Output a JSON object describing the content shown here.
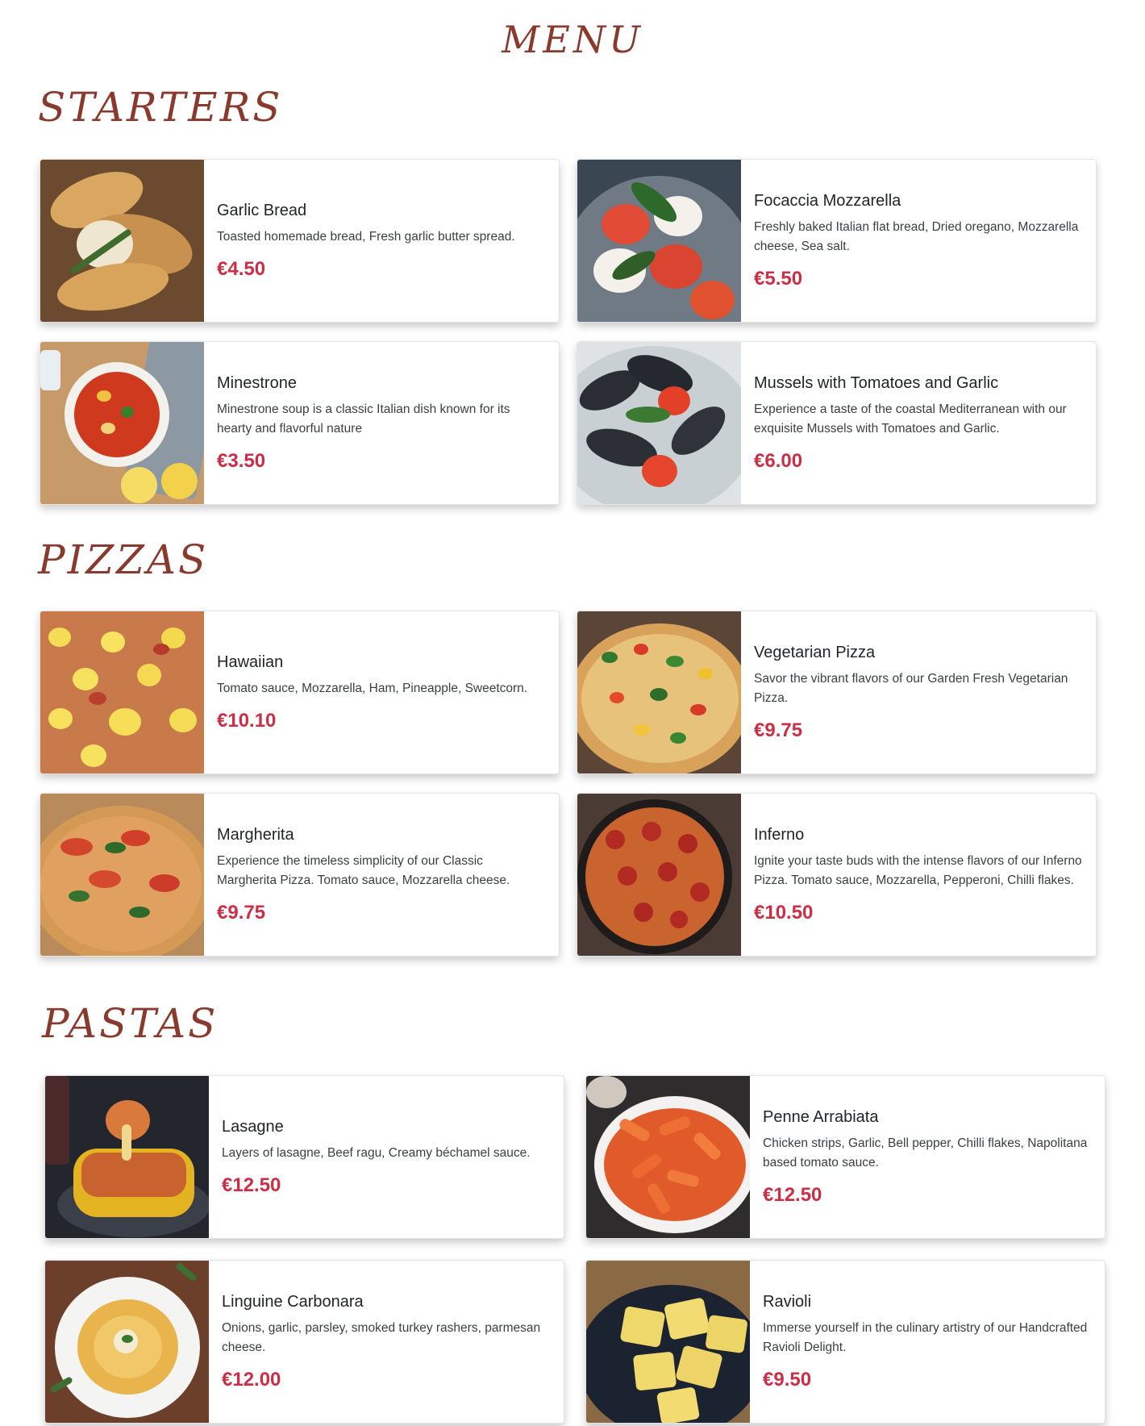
{
  "menu_title": "MENU",
  "sections": {
    "starters": {
      "title": "STARTERS",
      "items": [
        {
          "name": "Garlic Bread",
          "description": "Toasted homemade bread, Fresh garlic butter spread.",
          "price": "€4.50"
        },
        {
          "name": "Focaccia Mozzarella",
          "description": "Freshly baked Italian flat bread, Dried oregano, Mozzarella cheese, Sea salt.",
          "price": "€5.50"
        },
        {
          "name": "Minestrone",
          "description": "Minestrone soup is a classic Italian dish known for its hearty and flavorful nature",
          "price": "€3.50"
        },
        {
          "name": "Mussels with Tomatoes and Garlic",
          "description": "Experience a taste of the coastal Mediterranean with our exquisite Mussels with Tomatoes and Garlic.",
          "price": "€6.00"
        }
      ]
    },
    "pizzas": {
      "title": "PIZZAS",
      "items": [
        {
          "name": "Hawaiian",
          "description": "Tomato sauce, Mozzarella, Ham, Pineapple, Sweetcorn.",
          "price": "€10.10"
        },
        {
          "name": "Vegetarian Pizza",
          "description": "Savor the vibrant flavors of our Garden Fresh Vegetarian Pizza.",
          "price": "€9.75"
        },
        {
          "name": "Margherita",
          "description": "Experience the timeless simplicity of our Classic Margherita Pizza. Tomato sauce, Mozzarella cheese.",
          "price": "€9.75"
        },
        {
          "name": "Inferno",
          "description": "Ignite your taste buds with the intense flavors of our Inferno Pizza. Tomato sauce, Mozzarella, Pepperoni, Chilli flakes.",
          "price": "€10.50"
        }
      ]
    },
    "pastas": {
      "title": "PASTAS",
      "items": [
        {
          "name": "Lasagne",
          "description": "Layers of lasagne, Beef ragu, Creamy béchamel sauce.",
          "price": "€12.50"
        },
        {
          "name": "Penne Arrabiata",
          "description": "Chicken strips, Garlic, Bell pepper, Chilli flakes, Napolitana based tomato sauce.",
          "price": "€12.50"
        },
        {
          "name": "Linguine Carbonara",
          "description": "Onions, garlic, parsley, smoked turkey rashers, parmesan cheese.",
          "price": "€12.00"
        },
        {
          "name": "Ravioli",
          "description": "Immerse yourself in the culinary artistry of our Handcrafted Ravioli Delight.",
          "price": "€9.50"
        }
      ]
    }
  },
  "colors": {
    "accent": "#8a3a2c",
    "price": "#cc2f45"
  }
}
